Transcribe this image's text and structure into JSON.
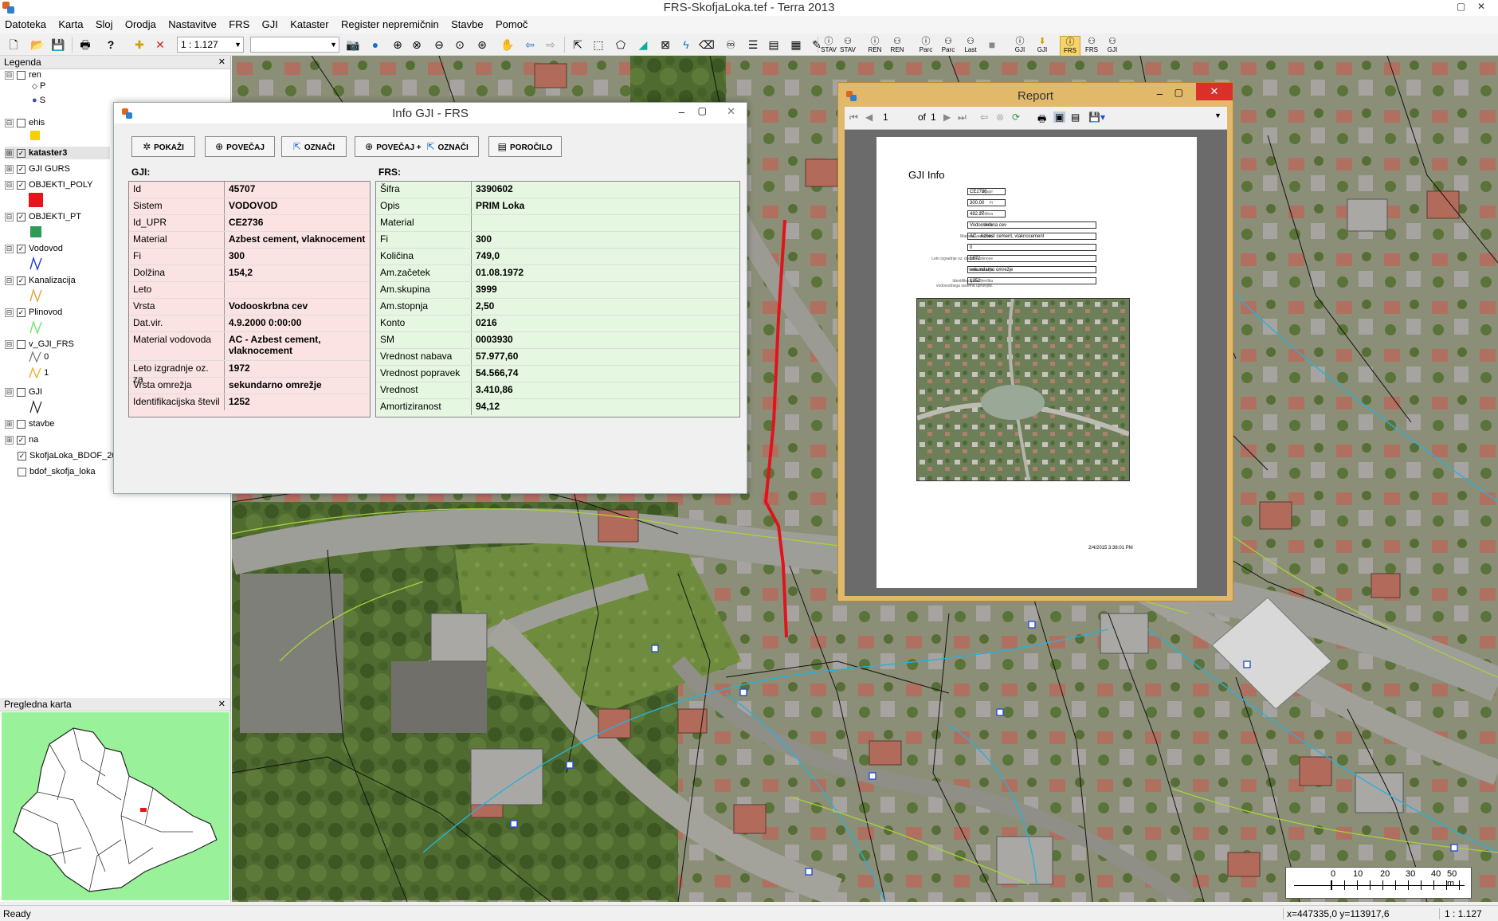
{
  "window": {
    "title": "FRS-SkofjaLoka.tef - Terra 2013"
  },
  "menu": [
    "Datoteka",
    "Karta",
    "Sloj",
    "Orodja",
    "Nastavitve",
    "FRS",
    "GJI",
    "Kataster",
    "Register nepremičnin",
    "Stavbe",
    "Pomoč"
  ],
  "toolbar": {
    "scale": "1 : 1.127",
    "layer_select": "",
    "labels": [
      "STAV",
      "STAV",
      "REN",
      "REN",
      "Parc",
      "Parc",
      "Last",
      "GJI",
      "GJI",
      "FRS",
      "FRS",
      "GJI"
    ]
  },
  "legend": {
    "title": "Legenda",
    "items": [
      {
        "label": "ren",
        "expand": "⊟",
        "checked": false
      },
      {
        "label": "P"
      },
      {
        "label": "S"
      },
      {
        "label": "ehis",
        "expand": "⊟",
        "checked": false
      },
      {
        "label": "kataster3",
        "expand": "⊞",
        "checked": true
      },
      {
        "label": "GJI GURS",
        "expand": "⊞",
        "checked": true
      },
      {
        "label": "OBJEKTI_POLY",
        "expand": "⊟",
        "checked": true
      },
      {
        "label": "OBJEKTI_PT",
        "expand": "⊟",
        "checked": true
      },
      {
        "label": "Vodovod",
        "expand": "⊟",
        "checked": true
      },
      {
        "label": "Kanalizacija",
        "expand": "⊟",
        "checked": true
      },
      {
        "label": "Plinovod",
        "expand": "⊟",
        "checked": true
      },
      {
        "label": "v_GJI_FRS",
        "expand": "⊟",
        "checked": false
      },
      {
        "label": "0"
      },
      {
        "label": "1"
      },
      {
        "label": "GJI",
        "expand": "⊟",
        "checked": false
      },
      {
        "label": "stavbe",
        "expand": "⊞",
        "checked": false
      },
      {
        "label": "na",
        "expand": "⊞",
        "checked": true
      },
      {
        "label": "SkofjaLoka_BDOF_20",
        "checked": true
      },
      {
        "label": "bdof_skofja_loka",
        "checked": false
      }
    ]
  },
  "overview": {
    "title": "Pregledna karta"
  },
  "info_dialog": {
    "title": "Info GJI - FRS",
    "buttons": [
      "POKAŽI",
      "POVEČAJ",
      "OZNAČI",
      "POVEČAJ +",
      "OZNAČI",
      "POROČILO"
    ],
    "gji_label": "GJI:",
    "frs_label": "FRS:",
    "gji": [
      {
        "k": "Id",
        "v": "45707"
      },
      {
        "k": "Sistem",
        "v": "VODOVOD"
      },
      {
        "k": "Id_UPR",
        "v": "CE2736"
      },
      {
        "k": "Material",
        "v": "Azbest cement, vlaknocement"
      },
      {
        "k": "Fi",
        "v": "300"
      },
      {
        "k": "Dolžina",
        "v": "154,2"
      },
      {
        "k": "Leto",
        "v": ""
      },
      {
        "k": "Vrsta",
        "v": "Vodooskrbna cev"
      },
      {
        "k": "Dat.vir.",
        "v": "4.9.2000 0:00:00"
      },
      {
        "k": "Material vodovoda",
        "v": "AC - Azbest cement, vlaknocement"
      },
      {
        "k": "Leto izgradnje oz. za",
        "v": "1972"
      },
      {
        "k": "Vrsta omrežja",
        "v": "sekundarno omrežje"
      },
      {
        "k": "Identifikacijska števil",
        "v": "1252"
      }
    ],
    "frs": [
      {
        "k": "Šifra",
        "v": "3390602"
      },
      {
        "k": "Opis",
        "v": "PRIM Loka"
      },
      {
        "k": "Material",
        "v": ""
      },
      {
        "k": "Fi",
        "v": "300"
      },
      {
        "k": "Količina",
        "v": "749,0"
      },
      {
        "k": "Am.začetek",
        "v": "01.08.1972"
      },
      {
        "k": "Am.skupina",
        "v": "3999"
      },
      {
        "k": "Am.stopnja",
        "v": "2,50"
      },
      {
        "k": "Konto",
        "v": "0216"
      },
      {
        "k": "SM",
        "v": "0003930"
      },
      {
        "k": "Vrednost nabava",
        "v": "57.977,60"
      },
      {
        "k": "Vrednost popravek",
        "v": "54.566,74"
      },
      {
        "k": "Vrednost",
        "v": "3.410,86"
      },
      {
        "k": "Amortiziranost",
        "v": "94,12"
      }
    ]
  },
  "report": {
    "title": "Report",
    "page": "1",
    "of": "of",
    "total": "1",
    "heading": "GJI Info",
    "fields": [
      {
        "k": "Id_upr",
        "v": "CE2736"
      },
      {
        "k": "Fi",
        "v": "300.00"
      },
      {
        "k": "Dolžina",
        "v": "482.27"
      },
      {
        "k": "Vrsta",
        "v": "Vodooskrbna cev"
      },
      {
        "k": "Material vodovoda",
        "v": "AC - Azbest cement, vlaknocement"
      },
      {
        "k": "",
        "v": "0"
      },
      {
        "k": "Leto izgradnje oz. dodatna obnove",
        "v": "1972"
      },
      {
        "k": "Vrsta omrežja",
        "v": "sekundarno omrežje"
      },
      {
        "k": "Identifikacijska številka vodovodnega sistema upravljav.",
        "v": "1252"
      }
    ],
    "timestamp": "2/4/2015 3:38:01 PM"
  },
  "scalebar": {
    "ticks": [
      "0",
      "10",
      "20",
      "30",
      "40",
      "50 m"
    ]
  },
  "status": {
    "text": "Ready",
    "coords": "x=447335,0 y=113917,6",
    "scale": "1 : 1.127"
  },
  "colors": {
    "pipe_selected": "#e0141c",
    "water_pipe": "#2ab0d8",
    "gas_pipe": "#a8d23a",
    "dialog_red": "#fbe3e3",
    "dialog_green": "#e5f6e1"
  }
}
